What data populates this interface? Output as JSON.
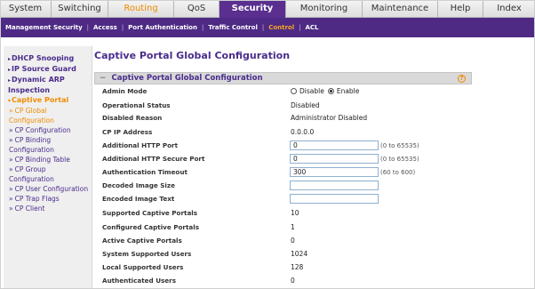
{
  "tabs": [
    {
      "label": "System",
      "width": 58
    },
    {
      "label": "Switching",
      "width": 64
    },
    {
      "label": "Routing",
      "width": 74
    },
    {
      "label": "QoS",
      "width": 51
    },
    {
      "label": "Security",
      "width": 75
    },
    {
      "label": "Monitoring",
      "width": 86
    },
    {
      "label": "Maintenance",
      "width": 85
    },
    {
      "label": "Help",
      "width": 51
    },
    {
      "label": "Index",
      "width": 58
    }
  ],
  "subnav": [
    "Management Security",
    "Access",
    "Port Authentication",
    "Traffic Control",
    "Control",
    "ACL"
  ],
  "sidebar": {
    "top_items": [
      "DHCP Snooping",
      "IP Source Guard",
      "Dynamic ARP Inspection",
      "Captive Portal"
    ],
    "sub_items": [
      "CP Global Configuration",
      "CP Configuration",
      "CP Binding Configuration",
      "CP Binding Table",
      "CP Group Configuration",
      "CP User Configuration",
      "CP Trap Flags",
      "CP Client"
    ]
  },
  "page_title": "Captive Portal Global Configuration",
  "panel": {
    "title": "Captive Portal Global Configuration",
    "help": "?",
    "minus": "−",
    "admin_mode": {
      "label": "Admin Mode",
      "disable": "Disable",
      "enable": "Enable"
    },
    "rows": {
      "operational_status": {
        "label": "Operational Status",
        "value": "Disabled"
      },
      "disabled_reason": {
        "label": "Disabled Reason",
        "value": "Administrator Disabled"
      },
      "cp_ip_address": {
        "label": "CP IP Address",
        "value": "0.0.0.0"
      },
      "http_port": {
        "label": "Additional HTTP Port",
        "value": "0",
        "range": "(0 to 65535)"
      },
      "https_port": {
        "label": "Additional HTTP Secure Port",
        "value": "0",
        "range": "(0 to 65535)"
      },
      "auth_timeout": {
        "label": "Authentication Timeout",
        "value": "300",
        "range": "(60 to 600)"
      },
      "decoded_image_size": {
        "label": "Decoded Image Size",
        "value": ""
      },
      "encoded_image_text": {
        "label": "Encoded Image Text",
        "value": ""
      },
      "supported_portals": {
        "label": "Supported Captive Portals",
        "value": "10"
      },
      "configured_portals": {
        "label": "Configured Captive Portals",
        "value": "1"
      },
      "active_portals": {
        "label": "Active Captive Portals",
        "value": "0"
      },
      "system_users": {
        "label": "System Supported Users",
        "value": "1024"
      },
      "local_users": {
        "label": "Local Supported Users",
        "value": "128"
      },
      "auth_users": {
        "label": "Authenticated Users",
        "value": "0"
      }
    }
  }
}
